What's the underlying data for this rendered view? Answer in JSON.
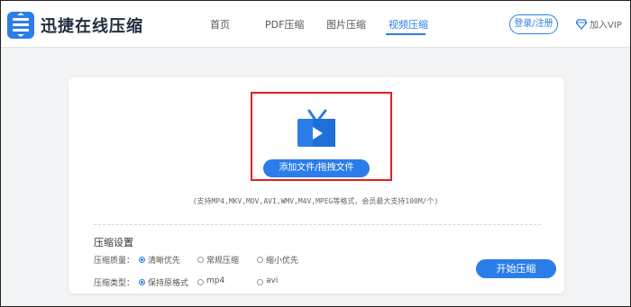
{
  "header": {
    "brand": "迅捷在线压缩",
    "nav": [
      {
        "label": "首页"
      },
      {
        "label": "PDF压缩"
      },
      {
        "label": "图片压缩"
      },
      {
        "label": "视频压缩",
        "active": true
      }
    ],
    "login_label": "登录/注册",
    "vip_label": "加入VIP",
    "accent_color": "#2b7de9"
  },
  "upload": {
    "icon": "tv-play-icon",
    "button_label": "添加文件/拖拽文件",
    "support_text": "(支持MP4,MKV,MOV,AVI,WMV,M4V,MPEG等格式，会员最大支持100M/个)",
    "highlight_color": "#e02020"
  },
  "settings": {
    "title": "压缩设置",
    "quality": {
      "label": "压缩质量：",
      "options": [
        {
          "label": "清晰优先",
          "selected": true
        },
        {
          "label": "常规压缩",
          "selected": false
        },
        {
          "label": "缩小优先",
          "selected": false
        }
      ]
    },
    "type": {
      "label": "压缩类型：",
      "options": [
        {
          "label": "保持原格式",
          "selected": true
        },
        {
          "label": "mp4",
          "selected": false
        },
        {
          "label": "avi",
          "selected": false
        }
      ]
    },
    "start_label": "开始压缩"
  }
}
